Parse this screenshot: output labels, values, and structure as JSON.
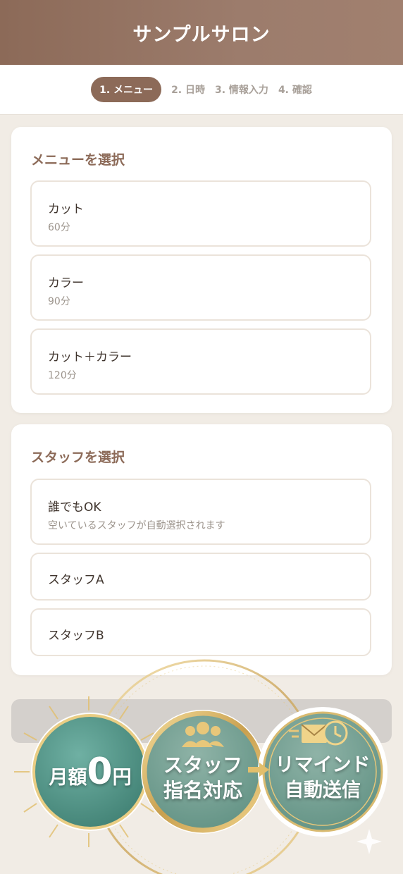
{
  "header": {
    "title": "サンプルサロン"
  },
  "steps": [
    "1. メニュー",
    "2. 日時",
    "3. 情報入力",
    "4. 確認"
  ],
  "menu": {
    "title": "メニューを選択",
    "options": [
      {
        "name": "カット",
        "duration": "60分"
      },
      {
        "name": "カラー",
        "duration": "90分"
      },
      {
        "name": "カット＋カラー",
        "duration": "120分"
      }
    ]
  },
  "staff": {
    "title": "スタッフを選択",
    "options": [
      {
        "name": "誰でもOK",
        "desc": "空いているスタッフが自動選択されます"
      },
      {
        "name": "スタッフA"
      },
      {
        "name": "スタッフB"
      }
    ]
  },
  "promo": {
    "badge1_prefix": "月額",
    "badge1_number": "0",
    "badge1_suffix": "円",
    "badge2_line1": "スタッフ",
    "badge2_line2": "指名対応",
    "badge3_line1": "リマインド",
    "badge3_line2": "自動送信"
  },
  "colors": {
    "brand": "#8c6a58",
    "teal": "#5f9a8d",
    "gold": "#d8b466"
  },
  "icons": [
    "group-icon",
    "mail-clock-icon",
    "arrow-right-icon",
    "sparkle-icon"
  ]
}
